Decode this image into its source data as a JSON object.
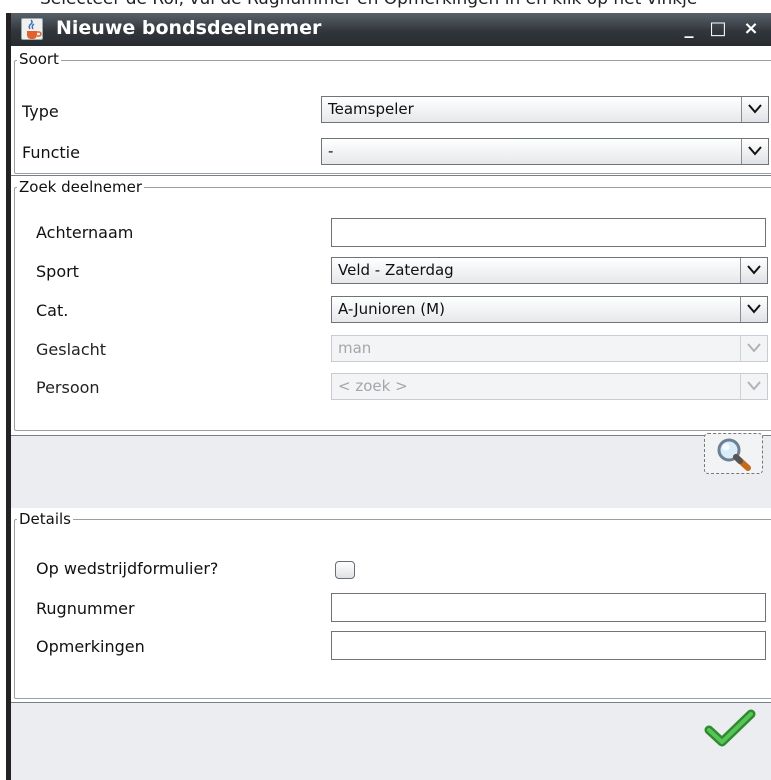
{
  "background_caption": "Selecteer de Rol, vul de Rugnummer en Opmerkingen in en klik op het vinkje",
  "window": {
    "title": "Nieuwe bondsdeelnemer",
    "controls": {
      "minimize": "_",
      "maximize": "□",
      "close": "×"
    }
  },
  "soort": {
    "legend": "Soort",
    "type_label": "Type",
    "type_value": "Teamspeler",
    "functie_label": "Functie",
    "functie_value": "-"
  },
  "zoek": {
    "legend": "Zoek deelnemer",
    "achternaam_label": "Achternaam",
    "achternaam_value": "",
    "sport_label": "Sport",
    "sport_value": "Veld - Zaterdag",
    "cat_label": "Cat.",
    "cat_value": "A-Junioren (M)",
    "geslacht_label": "Geslacht",
    "geslacht_value": "man",
    "persoon_label": "Persoon",
    "persoon_value": "< zoek >",
    "search_icon": "magnifier-icon"
  },
  "details": {
    "legend": "Details",
    "wedstrijd_label": "Op wedstrijdformulier?",
    "wedstrijd_checked": false,
    "rugnummer_label": "Rugnummer",
    "rugnummer_value": "",
    "opmerkingen_label": "Opmerkingen",
    "opmerkingen_value": "",
    "ok_icon": "checkmark-icon"
  },
  "colors": {
    "titlebar": "#31363c",
    "window_bg": "#ebedf0",
    "checkmark": "#3aa63a"
  }
}
